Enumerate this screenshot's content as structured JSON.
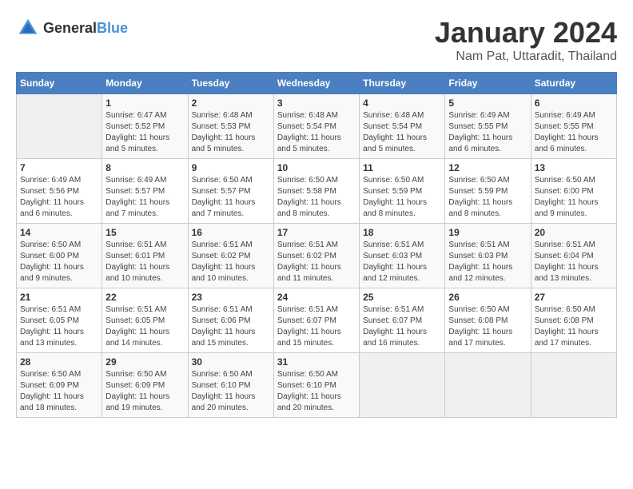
{
  "header": {
    "logo_general": "General",
    "logo_blue": "Blue",
    "title": "January 2024",
    "subtitle": "Nam Pat, Uttaradit, Thailand"
  },
  "calendar": {
    "days_of_week": [
      "Sunday",
      "Monday",
      "Tuesday",
      "Wednesday",
      "Thursday",
      "Friday",
      "Saturday"
    ],
    "weeks": [
      [
        {
          "day": "",
          "info": ""
        },
        {
          "day": "1",
          "info": "Sunrise: 6:47 AM\nSunset: 5:52 PM\nDaylight: 11 hours\nand 5 minutes."
        },
        {
          "day": "2",
          "info": "Sunrise: 6:48 AM\nSunset: 5:53 PM\nDaylight: 11 hours\nand 5 minutes."
        },
        {
          "day": "3",
          "info": "Sunrise: 6:48 AM\nSunset: 5:54 PM\nDaylight: 11 hours\nand 5 minutes."
        },
        {
          "day": "4",
          "info": "Sunrise: 6:48 AM\nSunset: 5:54 PM\nDaylight: 11 hours\nand 5 minutes."
        },
        {
          "day": "5",
          "info": "Sunrise: 6:49 AM\nSunset: 5:55 PM\nDaylight: 11 hours\nand 6 minutes."
        },
        {
          "day": "6",
          "info": "Sunrise: 6:49 AM\nSunset: 5:55 PM\nDaylight: 11 hours\nand 6 minutes."
        }
      ],
      [
        {
          "day": "7",
          "info": "Sunrise: 6:49 AM\nSunset: 5:56 PM\nDaylight: 11 hours\nand 6 minutes."
        },
        {
          "day": "8",
          "info": "Sunrise: 6:49 AM\nSunset: 5:57 PM\nDaylight: 11 hours\nand 7 minutes."
        },
        {
          "day": "9",
          "info": "Sunrise: 6:50 AM\nSunset: 5:57 PM\nDaylight: 11 hours\nand 7 minutes."
        },
        {
          "day": "10",
          "info": "Sunrise: 6:50 AM\nSunset: 5:58 PM\nDaylight: 11 hours\nand 8 minutes."
        },
        {
          "day": "11",
          "info": "Sunrise: 6:50 AM\nSunset: 5:59 PM\nDaylight: 11 hours\nand 8 minutes."
        },
        {
          "day": "12",
          "info": "Sunrise: 6:50 AM\nSunset: 5:59 PM\nDaylight: 11 hours\nand 8 minutes."
        },
        {
          "day": "13",
          "info": "Sunrise: 6:50 AM\nSunset: 6:00 PM\nDaylight: 11 hours\nand 9 minutes."
        }
      ],
      [
        {
          "day": "14",
          "info": "Sunrise: 6:50 AM\nSunset: 6:00 PM\nDaylight: 11 hours\nand 9 minutes."
        },
        {
          "day": "15",
          "info": "Sunrise: 6:51 AM\nSunset: 6:01 PM\nDaylight: 11 hours\nand 10 minutes."
        },
        {
          "day": "16",
          "info": "Sunrise: 6:51 AM\nSunset: 6:02 PM\nDaylight: 11 hours\nand 10 minutes."
        },
        {
          "day": "17",
          "info": "Sunrise: 6:51 AM\nSunset: 6:02 PM\nDaylight: 11 hours\nand 11 minutes."
        },
        {
          "day": "18",
          "info": "Sunrise: 6:51 AM\nSunset: 6:03 PM\nDaylight: 11 hours\nand 12 minutes."
        },
        {
          "day": "19",
          "info": "Sunrise: 6:51 AM\nSunset: 6:03 PM\nDaylight: 11 hours\nand 12 minutes."
        },
        {
          "day": "20",
          "info": "Sunrise: 6:51 AM\nSunset: 6:04 PM\nDaylight: 11 hours\nand 13 minutes."
        }
      ],
      [
        {
          "day": "21",
          "info": "Sunrise: 6:51 AM\nSunset: 6:05 PM\nDaylight: 11 hours\nand 13 minutes."
        },
        {
          "day": "22",
          "info": "Sunrise: 6:51 AM\nSunset: 6:05 PM\nDaylight: 11 hours\nand 14 minutes."
        },
        {
          "day": "23",
          "info": "Sunrise: 6:51 AM\nSunset: 6:06 PM\nDaylight: 11 hours\nand 15 minutes."
        },
        {
          "day": "24",
          "info": "Sunrise: 6:51 AM\nSunset: 6:07 PM\nDaylight: 11 hours\nand 15 minutes."
        },
        {
          "day": "25",
          "info": "Sunrise: 6:51 AM\nSunset: 6:07 PM\nDaylight: 11 hours\nand 16 minutes."
        },
        {
          "day": "26",
          "info": "Sunrise: 6:50 AM\nSunset: 6:08 PM\nDaylight: 11 hours\nand 17 minutes."
        },
        {
          "day": "27",
          "info": "Sunrise: 6:50 AM\nSunset: 6:08 PM\nDaylight: 11 hours\nand 17 minutes."
        }
      ],
      [
        {
          "day": "28",
          "info": "Sunrise: 6:50 AM\nSunset: 6:09 PM\nDaylight: 11 hours\nand 18 minutes."
        },
        {
          "day": "29",
          "info": "Sunrise: 6:50 AM\nSunset: 6:09 PM\nDaylight: 11 hours\nand 19 minutes."
        },
        {
          "day": "30",
          "info": "Sunrise: 6:50 AM\nSunset: 6:10 PM\nDaylight: 11 hours\nand 20 minutes."
        },
        {
          "day": "31",
          "info": "Sunrise: 6:50 AM\nSunset: 6:10 PM\nDaylight: 11 hours\nand 20 minutes."
        },
        {
          "day": "",
          "info": ""
        },
        {
          "day": "",
          "info": ""
        },
        {
          "day": "",
          "info": ""
        }
      ]
    ]
  }
}
